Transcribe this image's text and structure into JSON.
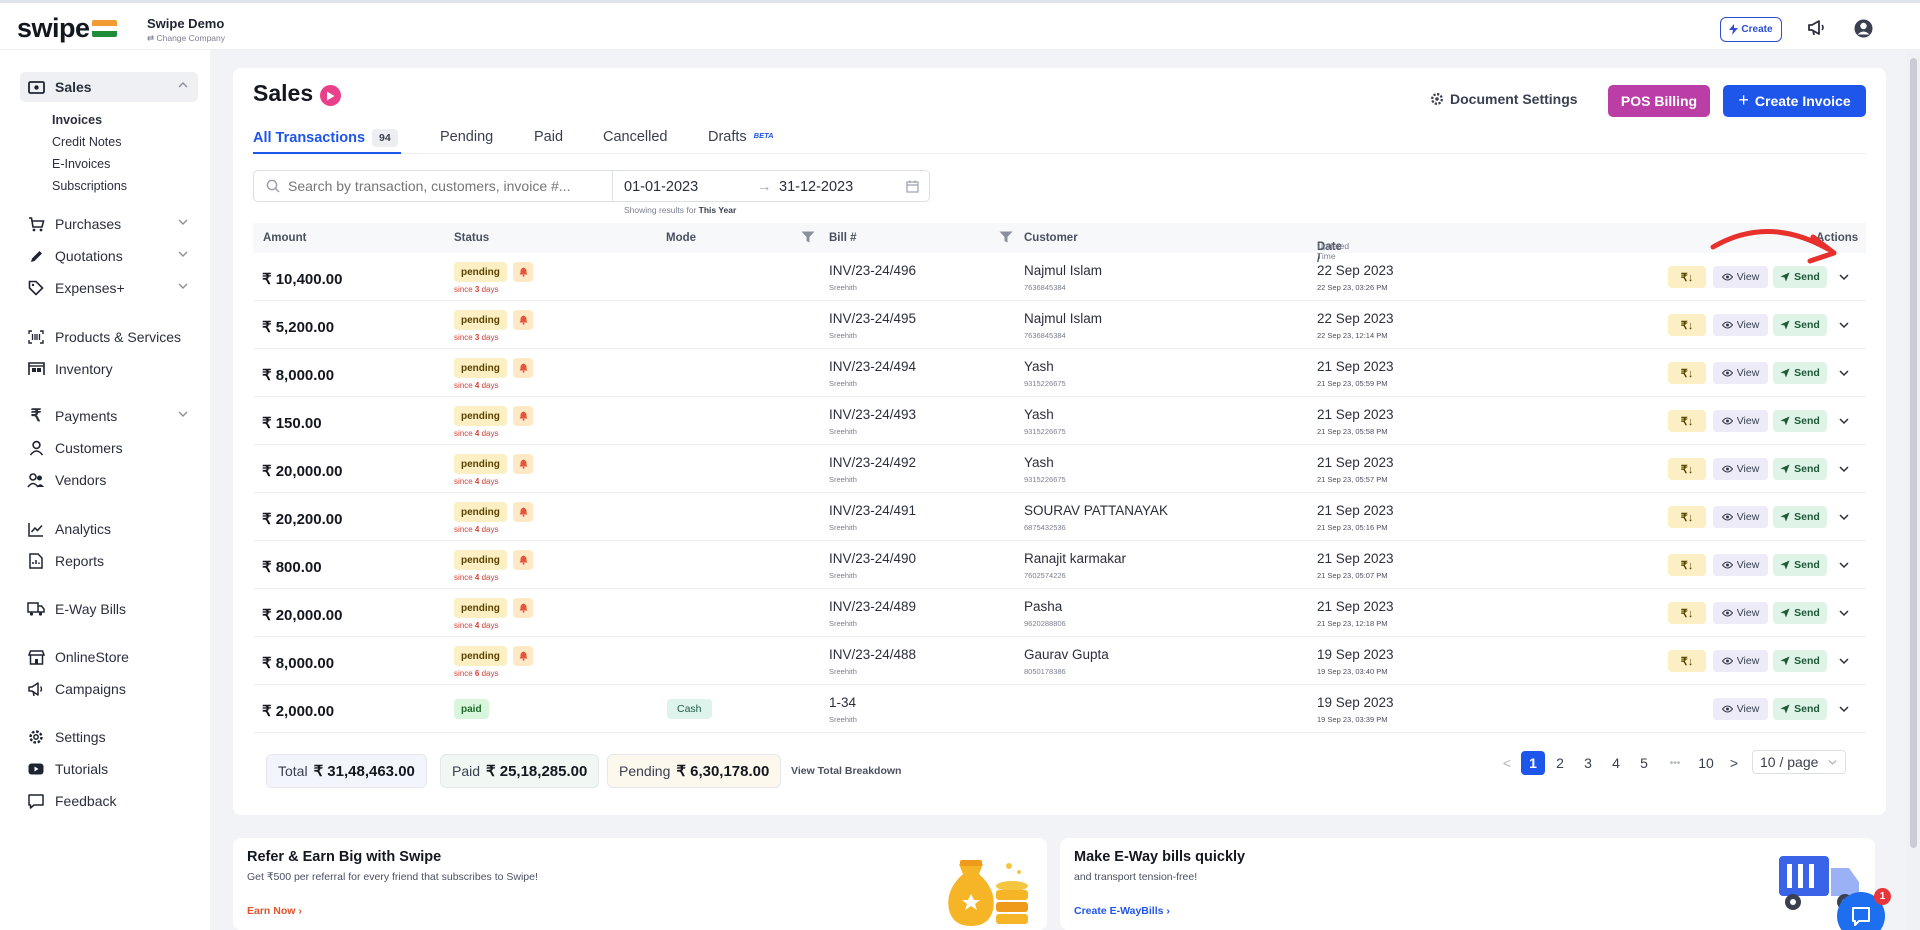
{
  "brand": {
    "logo": "swipe",
    "company_name": "Swipe Demo",
    "change_company": "⇄ Change Company"
  },
  "topbar": {
    "create_label": "Create",
    "create_icon": "lightning-icon",
    "campaign_icon": "megaphone-icon",
    "profile_icon": "user-icon"
  },
  "sidebar": {
    "sales": "Sales",
    "sales_items": [
      "Invoices",
      "Credit Notes",
      "E-Invoices",
      "Subscriptions"
    ],
    "purchases": "Purchases",
    "quotations": "Quotations",
    "expenses": "Expenses+",
    "products": "Products & Services",
    "inventory": "Inventory",
    "payments": "Payments",
    "customers": "Customers",
    "vendors": "Vendors",
    "analytics": "Analytics",
    "reports": "Reports",
    "eway": "E-Way Bills",
    "onlinestore": "OnlineStore",
    "campaigns": "Campaigns",
    "settings": "Settings",
    "tutorials": "Tutorials",
    "feedback": "Feedback"
  },
  "page": {
    "title": "Sales",
    "doc_settings": "Document Settings",
    "pos_billing": "POS Billing",
    "create_invoice": "Create Invoice"
  },
  "tabs": {
    "all": "All Transactions",
    "all_count": "94",
    "pending": "Pending",
    "paid": "Paid",
    "cancelled": "Cancelled",
    "drafts": "Drafts",
    "beta": "BETA"
  },
  "filters": {
    "search_placeholder": "Search by transaction, customers, invoice #...",
    "date_from": "01-01-2023",
    "date_to": "31-12-2023",
    "showing_prefix": "Showing results for",
    "showing_range": "This Year"
  },
  "table": {
    "headers": {
      "amount": "Amount",
      "status": "Status",
      "mode": "Mode",
      "bill": "Bill #",
      "customer": "Customer",
      "date": "Date /",
      "date_sub": "Updated Time",
      "actions": "Actions"
    },
    "pay_label": "₹↓",
    "view_label": "View",
    "send_label": "Send",
    "rows": [
      {
        "amount": "₹ 10,400.00",
        "status": "pending",
        "since_prefix": "since",
        "since_days": "3",
        "since_suffix": "days",
        "mode": "",
        "bill": "INV/23-24/496",
        "bill_sub": "Sreehith",
        "customer": "Najmul Islam",
        "phone": "7636845384",
        "date": "22 Sep 2023",
        "updated": "22 Sep 23, 03:26 PM"
      },
      {
        "amount": "₹ 5,200.00",
        "status": "pending",
        "since_prefix": "since",
        "since_days": "3",
        "since_suffix": "days",
        "mode": "",
        "bill": "INV/23-24/495",
        "bill_sub": "Sreehith",
        "customer": "Najmul Islam",
        "phone": "7636845384",
        "date": "22 Sep 2023",
        "updated": "22 Sep 23, 12:14 PM"
      },
      {
        "amount": "₹ 8,000.00",
        "status": "pending",
        "since_prefix": "since",
        "since_days": "4",
        "since_suffix": "days",
        "mode": "",
        "bill": "INV/23-24/494",
        "bill_sub": "Sreehith",
        "customer": "Yash",
        "phone": "9315226675",
        "date": "21 Sep 2023",
        "updated": "21 Sep 23, 05:59 PM"
      },
      {
        "amount": "₹ 150.00",
        "status": "pending",
        "since_prefix": "since",
        "since_days": "4",
        "since_suffix": "days",
        "mode": "",
        "bill": "INV/23-24/493",
        "bill_sub": "Sreehith",
        "customer": "Yash",
        "phone": "9315226675",
        "date": "21 Sep 2023",
        "updated": "21 Sep 23, 05:58 PM"
      },
      {
        "amount": "₹ 20,000.00",
        "status": "pending",
        "since_prefix": "since",
        "since_days": "4",
        "since_suffix": "days",
        "mode": "",
        "bill": "INV/23-24/492",
        "bill_sub": "Sreehith",
        "customer": "Yash",
        "phone": "9315226675",
        "date": "21 Sep 2023",
        "updated": "21 Sep 23, 05:57 PM"
      },
      {
        "amount": "₹ 20,200.00",
        "status": "pending",
        "since_prefix": "since",
        "since_days": "4",
        "since_suffix": "days",
        "mode": "",
        "bill": "INV/23-24/491",
        "bill_sub": "Sreehith",
        "customer": "SOURAV PATTANAYAK",
        "phone": "6875432536",
        "date": "21 Sep 2023",
        "updated": "21 Sep 23, 05:16 PM"
      },
      {
        "amount": "₹ 800.00",
        "status": "pending",
        "since_prefix": "since",
        "since_days": "4",
        "since_suffix": "days",
        "mode": "",
        "bill": "INV/23-24/490",
        "bill_sub": "Sreehith",
        "customer": "Ranajit karmakar",
        "phone": "7602574226",
        "date": "21 Sep 2023",
        "updated": "21 Sep 23, 05:07 PM"
      },
      {
        "amount": "₹ 20,000.00",
        "status": "pending",
        "since_prefix": "since",
        "since_days": "4",
        "since_suffix": "days",
        "mode": "",
        "bill": "INV/23-24/489",
        "bill_sub": "Sreehith",
        "customer": "Pasha",
        "phone": "9620288806",
        "date": "21 Sep 2023",
        "updated": "21 Sep 23, 12:18 PM"
      },
      {
        "amount": "₹ 8,000.00",
        "status": "pending",
        "since_prefix": "since",
        "since_days": "6",
        "since_suffix": "days",
        "mode": "",
        "bill": "INV/23-24/488",
        "bill_sub": "Sreehith",
        "customer": "Gaurav Gupta",
        "phone": "8050178386",
        "date": "19 Sep 2023",
        "updated": "19 Sep 23, 03:40 PM"
      },
      {
        "amount": "₹ 2,000.00",
        "status": "paid",
        "since_prefix": "",
        "since_days": "",
        "since_suffix": "",
        "mode": "Cash",
        "bill": "1-34",
        "bill_sub": "Sreehith",
        "customer": "",
        "phone": "",
        "date": "19 Sep 2023",
        "updated": "19 Sep 23, 03:39 PM"
      }
    ]
  },
  "summary": {
    "total_label": "Total",
    "total_value": "₹ 31,48,463.00",
    "paid_label": "Paid",
    "paid_value": "₹ 25,18,285.00",
    "pending_label": "Pending",
    "pending_value": "₹ 6,30,178.00",
    "breakdown": "View Total Breakdown"
  },
  "pagination": {
    "prev": "<",
    "pages": [
      "1",
      "2",
      "3",
      "4",
      "5"
    ],
    "ellipsis": "•••",
    "last": "10",
    "next": ">",
    "per_page": "10 / page",
    "current_page": 1
  },
  "promos": {
    "refer_title": "Refer & Earn Big with Swipe",
    "refer_sub": "Get ₹500 per referral for every friend that subscribes to Swipe!",
    "refer_link": "Earn Now",
    "eway_title": "Make E-Way bills quickly",
    "eway_sub": "and transport tension-free!",
    "eway_link": "Create E-WayBills"
  },
  "chat_badge": "1",
  "colors": {
    "primary": "#1e55ea",
    "pos": "#bb3da6",
    "pending_bg": "#fcefc4",
    "paid_bg": "#d9f5dc",
    "annotation_arrow": "#e8302c"
  }
}
